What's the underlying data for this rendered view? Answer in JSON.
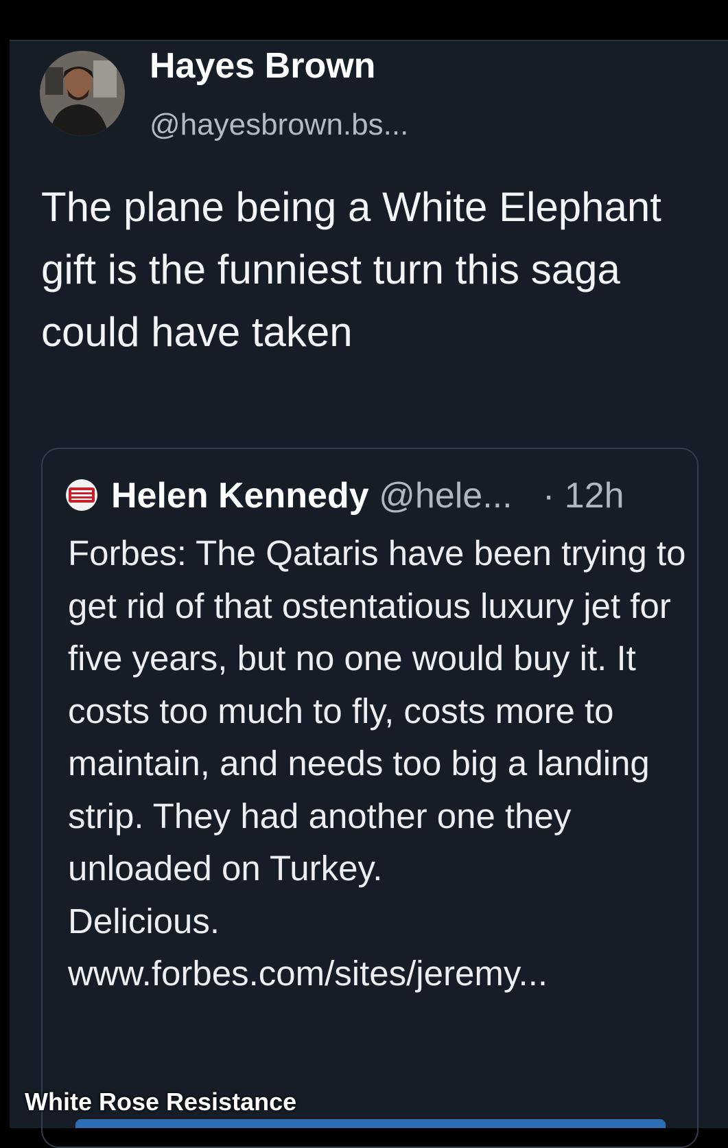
{
  "post": {
    "author_name": "Hayes Brown",
    "author_handle": "@hayesbrown.bs...",
    "text": "The plane being a White Elephant gift is the funniest turn this saga could have taken"
  },
  "quoted_post": {
    "author_name": "Helen Kennedy",
    "author_handle": "@hele...",
    "separator": "·",
    "time": "12h",
    "text": "Forbes: The Qataris have been trying to get rid of that ostentatious luxury jet for five years, but no one would buy it. It costs too much to fly, costs more to maintain, and needs too big a landing strip. They had another one they unloaded on Turkey.",
    "text_2": "Delicious.",
    "link": "www.forbes.com/sites/jeremy..."
  },
  "watermark": "White Rose Resistance",
  "colors": {
    "background": "#000000",
    "card": "#161d27",
    "muted_text": "#b3bac3",
    "accent_bar": "#2e6eb5"
  },
  "icons": {
    "avatar": "profile-photo",
    "quote_avatar": "news-badge-icon"
  }
}
